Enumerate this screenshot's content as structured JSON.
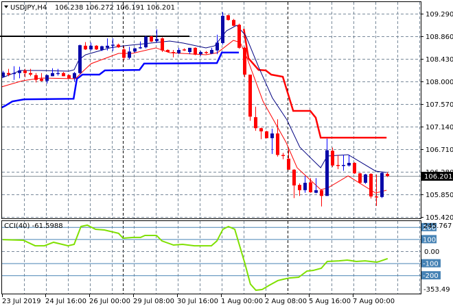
{
  "header": {
    "symbol": "USDJPY,H4",
    "ohlc": "106.238 106.272 106.191 106.201"
  },
  "price_axis": [
    "109.290",
    "108.860",
    "108.430",
    "108.000",
    "107.570",
    "107.140",
    "106.710",
    "106.280",
    "105.850",
    "105.420"
  ],
  "current_price": "106.201",
  "time_axis": [
    "23 Jul 2019",
    "24 Jul 16:00",
    "26 Jul 00:00",
    "29 Jul 08:00",
    "30 Jul 16:00",
    "1 Aug 00:00",
    "2 Aug 08:00",
    "5 Aug 16:00",
    "7 Aug 00:00"
  ],
  "cci": {
    "label": "CCI(40) -61.5988",
    "max_label": "245.767",
    "min_label": "-353.49",
    "zero_label": "0.00",
    "levels": [
      {
        "value": 200,
        "label": "200"
      },
      {
        "value": 100,
        "label": "100"
      },
      {
        "value": -100,
        "label": "-100"
      },
      {
        "value": -200,
        "label": "-200"
      }
    ]
  },
  "colors": {
    "bull": "#0a0aa8",
    "bull_wick": "#0000ff",
    "bear": "#ff0000",
    "cci": "#7fe000",
    "level": "#4682b4",
    "ma_fast": "#000080",
    "ma_slow": "#ff0000",
    "support": "#0000ff",
    "resistance": "#ff0000"
  },
  "chart_data": {
    "type": "candlestick",
    "title": "USDJPY,H4",
    "ylim": [
      105.42,
      109.29
    ],
    "candles": [
      [
        108.09,
        108.2,
        108.07,
        108.17
      ],
      [
        108.16,
        108.24,
        108.1,
        108.13
      ],
      [
        108.15,
        108.29,
        108.03,
        108.16
      ],
      [
        108.16,
        108.28,
        108.06,
        108.21
      ],
      [
        108.21,
        108.24,
        108.08,
        108.16
      ],
      [
        108.16,
        108.24,
        108.1,
        108.13
      ],
      [
        108.12,
        108.16,
        107.98,
        108.03
      ],
      [
        108.05,
        108.16,
        108.0,
        108.01
      ],
      [
        108.01,
        108.13,
        107.96,
        108.12
      ],
      [
        108.1,
        108.25,
        108.1,
        108.16
      ],
      [
        108.15,
        108.24,
        108.11,
        108.16
      ],
      [
        108.16,
        108.18,
        108.1,
        108.1
      ],
      [
        108.12,
        108.13,
        108.06,
        108.06
      ],
      [
        108.06,
        108.18,
        108.0,
        108.16
      ],
      [
        108.16,
        108.7,
        108.14,
        108.69
      ],
      [
        108.68,
        108.75,
        108.6,
        108.61
      ],
      [
        108.61,
        108.74,
        108.59,
        108.68
      ],
      [
        108.68,
        108.69,
        108.6,
        108.61
      ],
      [
        108.6,
        108.68,
        108.58,
        108.67
      ],
      [
        108.64,
        108.82,
        108.59,
        108.68
      ],
      [
        108.68,
        108.82,
        108.58,
        108.7
      ],
      [
        108.7,
        108.72,
        108.64,
        108.65
      ],
      [
        108.61,
        108.67,
        108.4,
        108.45
      ],
      [
        108.45,
        108.66,
        108.42,
        108.57
      ],
      [
        108.57,
        108.64,
        108.55,
        108.63
      ],
      [
        108.64,
        108.76,
        108.62,
        108.65
      ],
      [
        108.65,
        108.87,
        108.63,
        108.85
      ],
      [
        108.86,
        108.87,
        108.75,
        108.76
      ],
      [
        108.77,
        108.99,
        108.74,
        108.81
      ],
      [
        108.82,
        108.84,
        108.56,
        108.59
      ],
      [
        108.6,
        108.61,
        108.55,
        108.56
      ],
      [
        108.56,
        108.6,
        108.46,
        108.55
      ],
      [
        108.54,
        108.64,
        108.52,
        108.6
      ],
      [
        108.61,
        108.63,
        108.58,
        108.59
      ],
      [
        108.56,
        108.64,
        108.52,
        108.64
      ],
      [
        108.64,
        108.65,
        108.5,
        108.51
      ],
      [
        108.52,
        108.58,
        108.49,
        108.56
      ],
      [
        108.56,
        108.58,
        108.52,
        108.55
      ],
      [
        108.53,
        108.64,
        108.52,
        108.6
      ],
      [
        108.59,
        108.89,
        108.52,
        108.74
      ],
      [
        108.73,
        109.32,
        108.7,
        109.25
      ],
      [
        109.26,
        109.27,
        109.16,
        109.17
      ],
      [
        109.17,
        109.19,
        109.05,
        109.06
      ],
      [
        109.08,
        109.1,
        108.62,
        108.64
      ],
      [
        108.64,
        108.66,
        108.08,
        108.13
      ],
      [
        108.13,
        108.13,
        107.25,
        107.33
      ],
      [
        107.32,
        107.52,
        107.06,
        107.11
      ],
      [
        107.11,
        107.12,
        106.9,
        107.05
      ],
      [
        107.05,
        107.06,
        106.92,
        106.92
      ],
      [
        106.92,
        107.1,
        106.62,
        107.01
      ],
      [
        107.01,
        107.28,
        106.57,
        106.6
      ],
      [
        106.6,
        106.64,
        106.52,
        106.59
      ],
      [
        106.53,
        106.72,
        106.32,
        106.32
      ],
      [
        106.32,
        106.33,
        105.78,
        106.02
      ],
      [
        106.03,
        106.06,
        105.82,
        105.93
      ],
      [
        105.93,
        106.2,
        105.88,
        106.07
      ],
      [
        106.08,
        106.16,
        105.88,
        105.89
      ],
      [
        105.88,
        106.16,
        105.87,
        105.93
      ],
      [
        105.93,
        105.94,
        105.62,
        105.82
      ],
      [
        105.82,
        106.91,
        105.82,
        106.69
      ],
      [
        106.68,
        106.74,
        106.37,
        106.4
      ],
      [
        106.41,
        106.6,
        106.33,
        106.4
      ],
      [
        106.4,
        106.6,
        106.3,
        106.41
      ],
      [
        106.4,
        106.6,
        106.38,
        106.45
      ],
      [
        106.45,
        106.46,
        106.24,
        106.25
      ],
      [
        106.25,
        106.26,
        106.05,
        106.07
      ],
      [
        106.07,
        106.24,
        106.05,
        106.23
      ],
      [
        106.24,
        106.25,
        105.77,
        105.81
      ],
      [
        105.81,
        106.23,
        105.63,
        105.8
      ],
      [
        105.8,
        106.27,
        105.78,
        106.26
      ],
      [
        106.24,
        106.27,
        106.18,
        106.2
      ]
    ],
    "ma_fast": [
      [
        -0.25,
        108.065
      ],
      [
        3.25,
        108.209
      ],
      [
        7,
        108.209
      ],
      [
        12,
        108.196
      ],
      [
        13,
        108.222
      ],
      [
        13.9,
        108.417
      ],
      [
        15.1,
        108.508
      ],
      [
        16.4,
        108.547
      ],
      [
        19.5,
        108.639
      ],
      [
        22,
        108.678
      ],
      [
        24.5,
        108.704
      ],
      [
        30.4,
        108.769
      ],
      [
        32.9,
        108.73
      ],
      [
        37,
        108.639
      ],
      [
        38.6,
        108.678
      ],
      [
        40.75,
        108.964
      ],
      [
        42.6,
        109.068
      ],
      [
        44.25,
        108.873
      ],
      [
        46.6,
        108.274
      ],
      [
        49.1,
        107.687
      ],
      [
        51.75,
        107.27
      ],
      [
        54.1,
        106.749
      ],
      [
        56.1,
        106.541
      ],
      [
        57.9,
        106.358
      ],
      [
        59.1,
        106.58
      ],
      [
        62.9,
        106.606
      ],
      [
        67.9,
        106.293
      ],
      [
        69.9,
        106.267
      ]
    ],
    "ma_slow": [
      [
        -0.25,
        107.896
      ],
      [
        3.6,
        108.013
      ],
      [
        7,
        108.065
      ],
      [
        13.25,
        108.052
      ],
      [
        14.5,
        108.182
      ],
      [
        16.1,
        108.339
      ],
      [
        21.1,
        108.534
      ],
      [
        23.6,
        108.534
      ],
      [
        27.9,
        108.639
      ],
      [
        30.4,
        108.547
      ],
      [
        37,
        108.508
      ],
      [
        39.1,
        108.547
      ],
      [
        42,
        108.782
      ],
      [
        43.25,
        108.743
      ],
      [
        44.5,
        108.443
      ],
      [
        47.4,
        107.622
      ],
      [
        51.6,
        106.84
      ],
      [
        53.6,
        106.358
      ],
      [
        57.9,
        105.941
      ],
      [
        59.1,
        105.967
      ],
      [
        62.9,
        106.202
      ],
      [
        67.9,
        105.876
      ],
      [
        69.9,
        105.928
      ]
    ],
    "support": [
      [
        -0.25,
        107.5
      ],
      [
        0.5,
        107.54
      ],
      [
        1.75,
        107.62
      ],
      [
        3.9,
        107.66
      ],
      [
        12.9,
        107.67
      ],
      [
        13.5,
        108.05
      ],
      [
        13.9,
        108.08
      ],
      [
        14.5,
        108.13
      ],
      [
        17.6,
        108.13
      ],
      [
        18.6,
        108.21
      ],
      [
        24.9,
        108.22
      ],
      [
        25.75,
        108.34
      ],
      [
        39,
        108.35
      ],
      [
        39.9,
        108.55
      ],
      [
        43,
        108.55
      ]
    ],
    "resistance": [
      [
        43.9,
        109.0
      ],
      [
        44.75,
        108.44
      ],
      [
        46.6,
        108.22
      ],
      [
        47.9,
        108.21
      ],
      [
        48.9,
        108.13
      ],
      [
        51,
        108.09
      ],
      [
        52.9,
        107.44
      ],
      [
        56,
        107.44
      ],
      [
        57,
        107.31
      ],
      [
        57.9,
        106.93
      ],
      [
        69.9,
        106.93
      ]
    ],
    "hline": {
      "price": 108.86,
      "from": -0.5,
      "to": 34
    },
    "cci_series": [
      [
        0,
        96
      ],
      [
        3.75,
        91
      ],
      [
        5.9,
        45
      ],
      [
        7.6,
        45
      ],
      [
        9.25,
        74
      ],
      [
        11.9,
        45
      ],
      [
        13,
        57
      ],
      [
        14.25,
        205
      ],
      [
        15.4,
        216
      ],
      [
        16.9,
        182
      ],
      [
        18.5,
        176
      ],
      [
        21.1,
        148
      ],
      [
        21.9,
        108
      ],
      [
        23.75,
        114
      ],
      [
        25.1,
        114
      ],
      [
        25.9,
        131
      ],
      [
        28,
        131
      ],
      [
        29,
        85
      ],
      [
        31.1,
        51
      ],
      [
        32.75,
        57
      ],
      [
        34.9,
        45
      ],
      [
        38,
        45
      ],
      [
        39,
        85
      ],
      [
        40.1,
        182
      ],
      [
        41.1,
        205
      ],
      [
        42.25,
        182
      ],
      [
        44.1,
        -102
      ],
      [
        45.1,
        -273
      ],
      [
        46.1,
        -324
      ],
      [
        47.25,
        -318
      ],
      [
        48.5,
        -284
      ],
      [
        50.1,
        -244
      ],
      [
        51.1,
        -233
      ],
      [
        52.25,
        -222
      ],
      [
        53.9,
        -216
      ],
      [
        55.4,
        -165
      ],
      [
        56.5,
        -160
      ],
      [
        58,
        -142
      ],
      [
        59.1,
        -85
      ],
      [
        61.25,
        -80
      ],
      [
        62.75,
        -74
      ],
      [
        64.4,
        -85
      ],
      [
        66,
        -80
      ],
      [
        68.1,
        -91
      ],
      [
        68.6,
        -85
      ],
      [
        70.1,
        -61.6
      ]
    ]
  }
}
